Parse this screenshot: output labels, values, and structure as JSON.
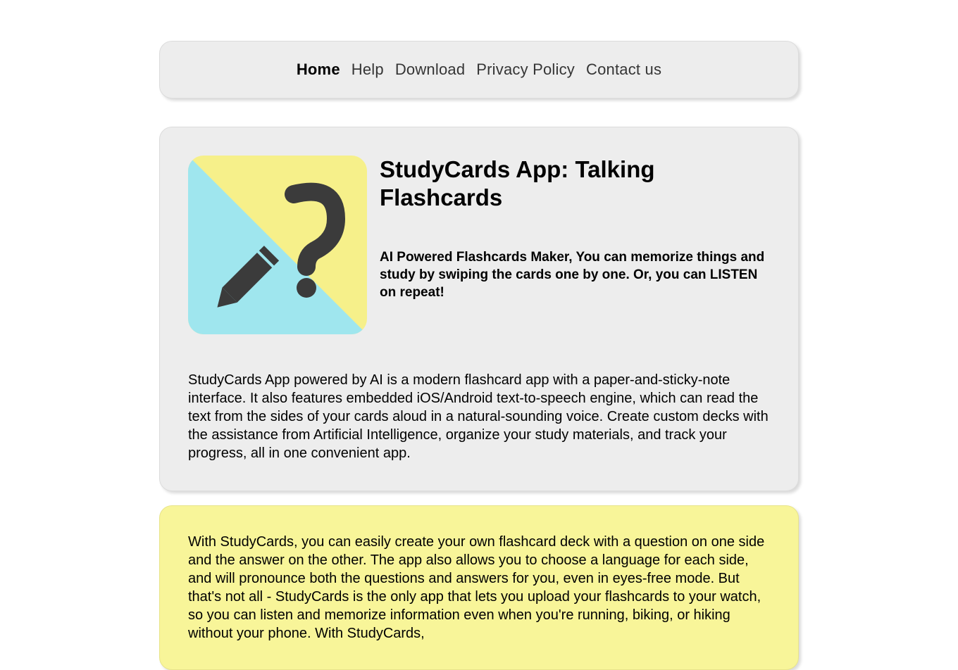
{
  "nav": {
    "items": [
      {
        "label": "Home"
      },
      {
        "label": "Help"
      },
      {
        "label": "Download"
      },
      {
        "label": "Privacy Policy"
      },
      {
        "label": "Contact us"
      }
    ]
  },
  "hero": {
    "title": "StudyCards App: Talking Flashcards",
    "tagline": "AI Powered Flashcards Maker, You can memorize things and study by swiping the cards one by one. Or, you can LISTEN on repeat!",
    "body": "StudyCards App powered by AI is a modern flashcard app with a paper-and-sticky-note interface. It also features embedded iOS/Android text-to-speech engine, which can read the text from the sides of your cards aloud in a natural-sounding voice. Create custom decks with the assistance from Artificial Intelligence, organize your study materials, and track your progress, all in one convenient app."
  },
  "feature_paragraph": "With StudyCards, you can easily create your own flashcard deck with a question on one side and the answer on the other. The app also allows you to choose a language for each side, and will pronounce both the questions and answers for you, even in eyes-free mode. But that's not all - StudyCards is the only app that lets you upload your flashcards to your watch, so you can listen and memorize information even when you're running, biking, or hiking without your phone. With StudyCards,",
  "colors": {
    "logo_yellow": "#f6f08a",
    "logo_cyan": "#9fe6ee",
    "icon": "#3b3b3b"
  }
}
